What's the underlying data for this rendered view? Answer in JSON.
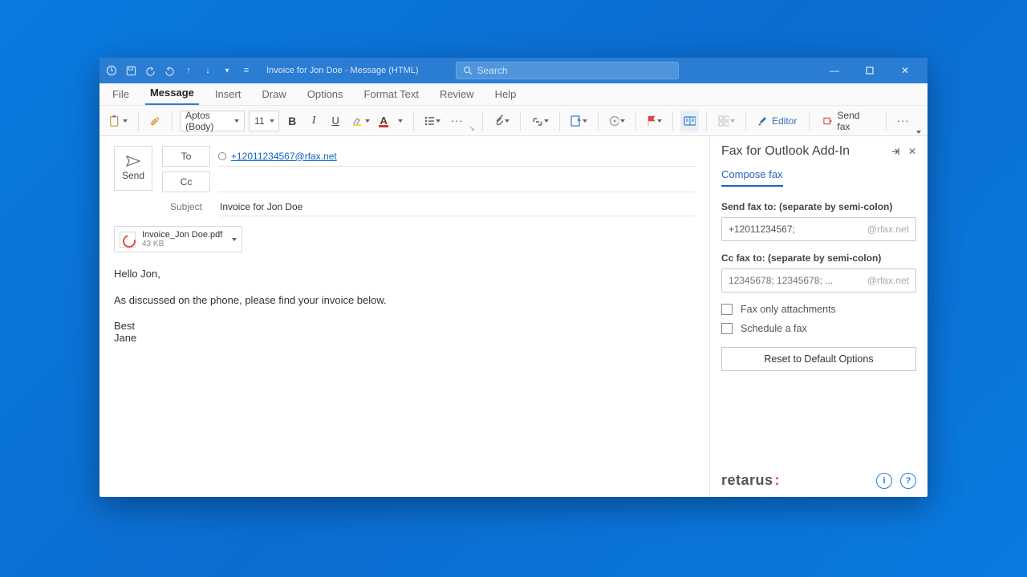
{
  "titlebar": {
    "title": "Invoice for Jon Doe  -  Message (HTML)",
    "search_placeholder": "Search"
  },
  "menu": [
    "File",
    "Message",
    "Insert",
    "Draw",
    "Options",
    "Format Text",
    "Review",
    "Help"
  ],
  "menu_active": "Message",
  "ribbon": {
    "font_name": "Aptos (Body)",
    "font_size": "11",
    "editor_label": "Editor",
    "sendfax_label": "Send fax"
  },
  "compose": {
    "send_label": "Send",
    "to_label": "To",
    "cc_label": "Cc",
    "subject_label": "Subject",
    "to_value": "+12011234567@rfax.net",
    "cc_value": "",
    "subject_value": "Invoice for Jon Doe",
    "attachment": {
      "name": "Invoice_Jon Doe.pdf",
      "size": "43 KB"
    },
    "body_p1": "Hello Jon,",
    "body_p2": "As discussed on the phone, please find your invoice below.",
    "body_p3": "Best",
    "body_p4": "Jane"
  },
  "pane": {
    "title": "Fax for Outlook Add-In",
    "tab": "Compose fax",
    "sendto_label": "Send fax to: (separate by semi-colon)",
    "sendto_value": "+12011234567;",
    "ccto_label": "Cc fax to: (separate by semi-colon)",
    "ccto_placeholder": "12345678; 12345678; ...",
    "suffix": "@rfax.net",
    "opt_attachments": "Fax only attachments",
    "opt_schedule": "Schedule a fax",
    "reset_label": "Reset to Default Options",
    "brand": "retarus"
  }
}
